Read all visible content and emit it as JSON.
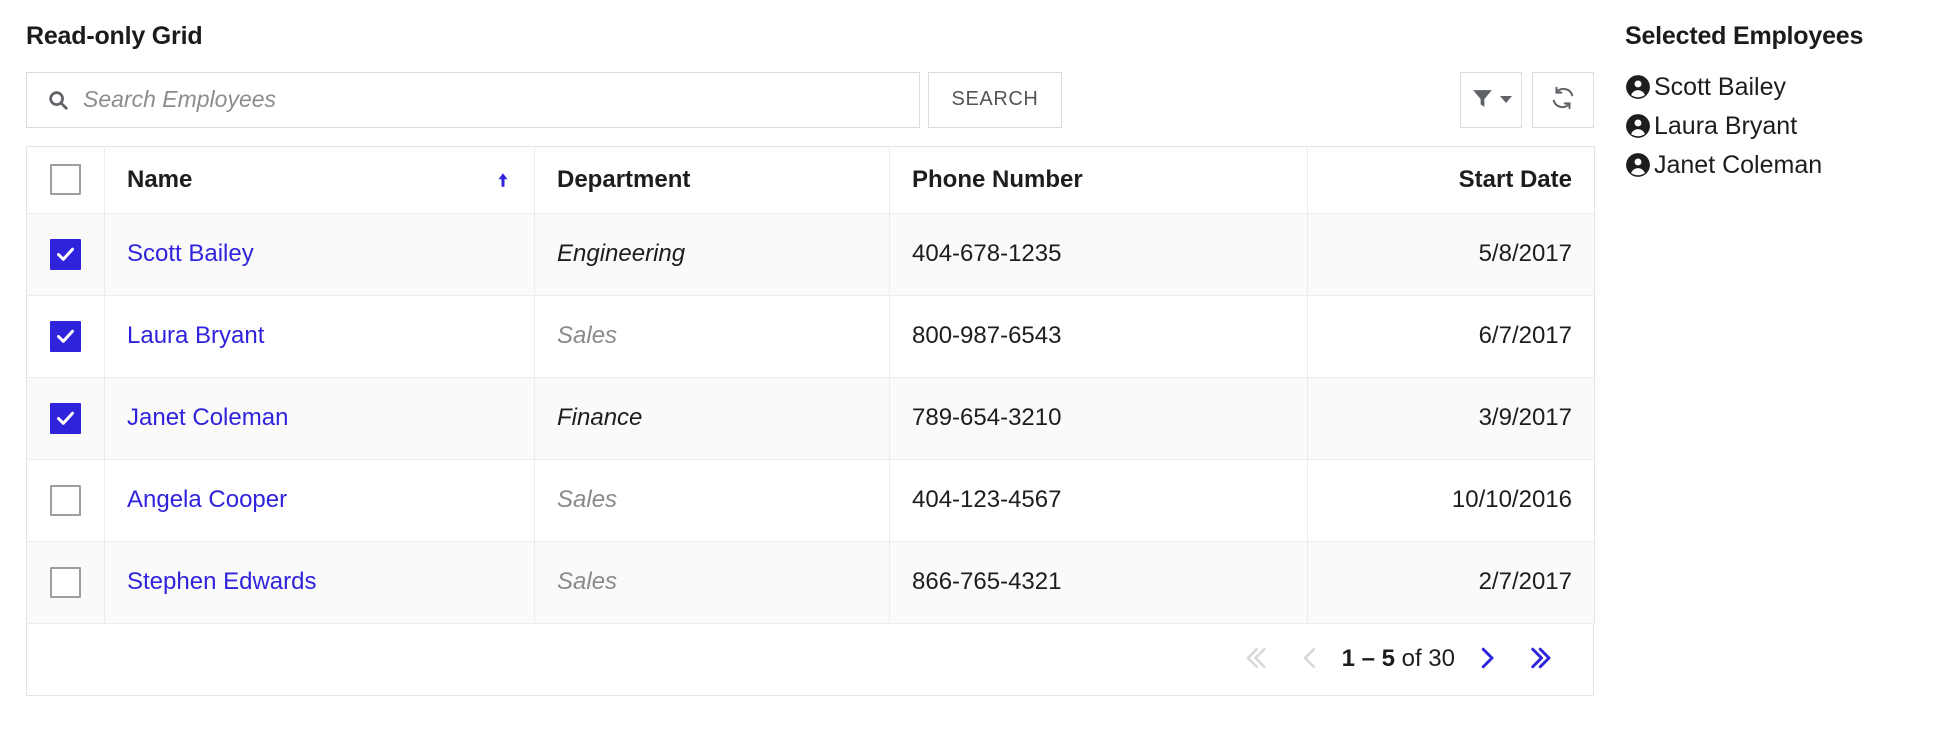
{
  "panel": {
    "title": "Read-only Grid"
  },
  "search": {
    "placeholder": "Search Employees",
    "value": "",
    "button_label": "SEARCH",
    "icon": "search-icon"
  },
  "toolbar": {
    "filter_icon": "filter-funnel-icon",
    "filter_caret_icon": "chevron-down-icon",
    "refresh_icon": "refresh-icon"
  },
  "table": {
    "columns": [
      {
        "key": "select",
        "label": "",
        "align": "center"
      },
      {
        "key": "name",
        "label": "Name",
        "align": "left",
        "sorted": "asc",
        "sort_icon": "arrow-up-icon"
      },
      {
        "key": "department",
        "label": "Department",
        "align": "left"
      },
      {
        "key": "phone",
        "label": "Phone Number",
        "align": "left"
      },
      {
        "key": "startDate",
        "label": "Start Date",
        "align": "right"
      }
    ],
    "header_select_all": false,
    "rows": [
      {
        "selected": true,
        "name": "Scott Bailey",
        "department": "Engineering",
        "department_style": "strong",
        "phone": "404-678-1235",
        "startDate": "5/8/2017"
      },
      {
        "selected": true,
        "name": "Laura Bryant",
        "department": "Sales",
        "department_style": "muted",
        "phone": "800-987-6543",
        "startDate": "6/7/2017"
      },
      {
        "selected": true,
        "name": "Janet Coleman",
        "department": "Finance",
        "department_style": "strong",
        "phone": "789-654-3210",
        "startDate": "3/9/2017"
      },
      {
        "selected": false,
        "name": "Angela Cooper",
        "department": "Sales",
        "department_style": "muted",
        "phone": "404-123-4567",
        "startDate": "10/10/2016"
      },
      {
        "selected": false,
        "name": "Stephen Edwards",
        "department": "Sales",
        "department_style": "muted",
        "phone": "866-765-4321",
        "startDate": "2/7/2017"
      }
    ]
  },
  "paginator": {
    "range_bold": "1 – 5",
    "range_rest": " of 30",
    "first_icon": "chevron-double-left-icon",
    "prev_icon": "chevron-left-icon",
    "next_icon": "chevron-right-icon",
    "last_icon": "chevron-double-right-icon",
    "first_enabled": false,
    "prev_enabled": false,
    "next_enabled": true,
    "last_enabled": true
  },
  "selected_panel": {
    "title": "Selected Employees",
    "items": [
      {
        "name": "Scott Bailey",
        "icon": "person-circle-icon"
      },
      {
        "name": "Laura Bryant",
        "icon": "person-circle-icon"
      },
      {
        "name": "Janet Coleman",
        "icon": "person-circle-icon"
      }
    ]
  },
  "colors": {
    "accent": "#3023dc",
    "link": "#3023dc",
    "muted_text": "#8a8a8a",
    "border": "#e3e3e3",
    "row_stripe": "#fafafa",
    "disabled": "#d8d8d8"
  }
}
